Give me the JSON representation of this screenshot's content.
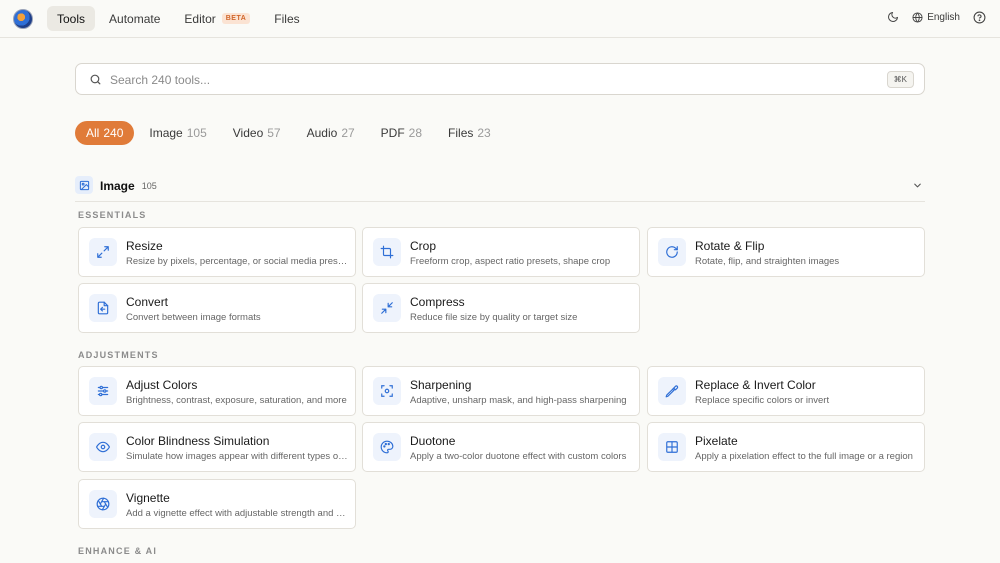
{
  "nav": {
    "tabs": [
      {
        "label": "Tools"
      },
      {
        "label": "Automate"
      },
      {
        "label": "Editor",
        "badge": "BETA"
      },
      {
        "label": "Files"
      }
    ],
    "language": "English"
  },
  "search": {
    "placeholder": "Search 240 tools...",
    "shortcut": "⌘K"
  },
  "filters": [
    {
      "label": "All",
      "count": "240"
    },
    {
      "label": "Image",
      "count": "105"
    },
    {
      "label": "Video",
      "count": "57"
    },
    {
      "label": "Audio",
      "count": "27"
    },
    {
      "label": "PDF",
      "count": "28"
    },
    {
      "label": "Files",
      "count": "23"
    }
  ],
  "section": {
    "title": "Image",
    "count": "105"
  },
  "groups": {
    "essentials": "ESSENTIALS",
    "adjustments": "ADJUSTMENTS",
    "enhance": "ENHANCE & AI"
  },
  "tools": {
    "resize": {
      "title": "Resize",
      "desc": "Resize by pixels, percentage, or social media presets"
    },
    "crop": {
      "title": "Crop",
      "desc": "Freeform crop, aspect ratio presets, shape crop"
    },
    "rotate": {
      "title": "Rotate & Flip",
      "desc": "Rotate, flip, and straighten images"
    },
    "convert": {
      "title": "Convert",
      "desc": "Convert between image formats"
    },
    "compress": {
      "title": "Compress",
      "desc": "Reduce file size by quality or target size"
    },
    "adjust_colors": {
      "title": "Adjust Colors",
      "desc": "Brightness, contrast, exposure, saturation, and more"
    },
    "sharpening": {
      "title": "Sharpening",
      "desc": "Adaptive, unsharp mask, and high-pass sharpening"
    },
    "replace_color": {
      "title": "Replace & Invert Color",
      "desc": "Replace specific colors or invert"
    },
    "color_blindness": {
      "title": "Color Blindness Simulation",
      "desc": "Simulate how images appear with different types of color blindness"
    },
    "duotone": {
      "title": "Duotone",
      "desc": "Apply a two-color duotone effect with custom colors"
    },
    "pixelate": {
      "title": "Pixelate",
      "desc": "Apply a pixelation effect to the full image or a region"
    },
    "vignette": {
      "title": "Vignette",
      "desc": "Add a vignette effect with adjustable strength and size"
    }
  },
  "colors": {
    "accent": "#e07b39",
    "icon_blue": "#2f6fd6"
  }
}
